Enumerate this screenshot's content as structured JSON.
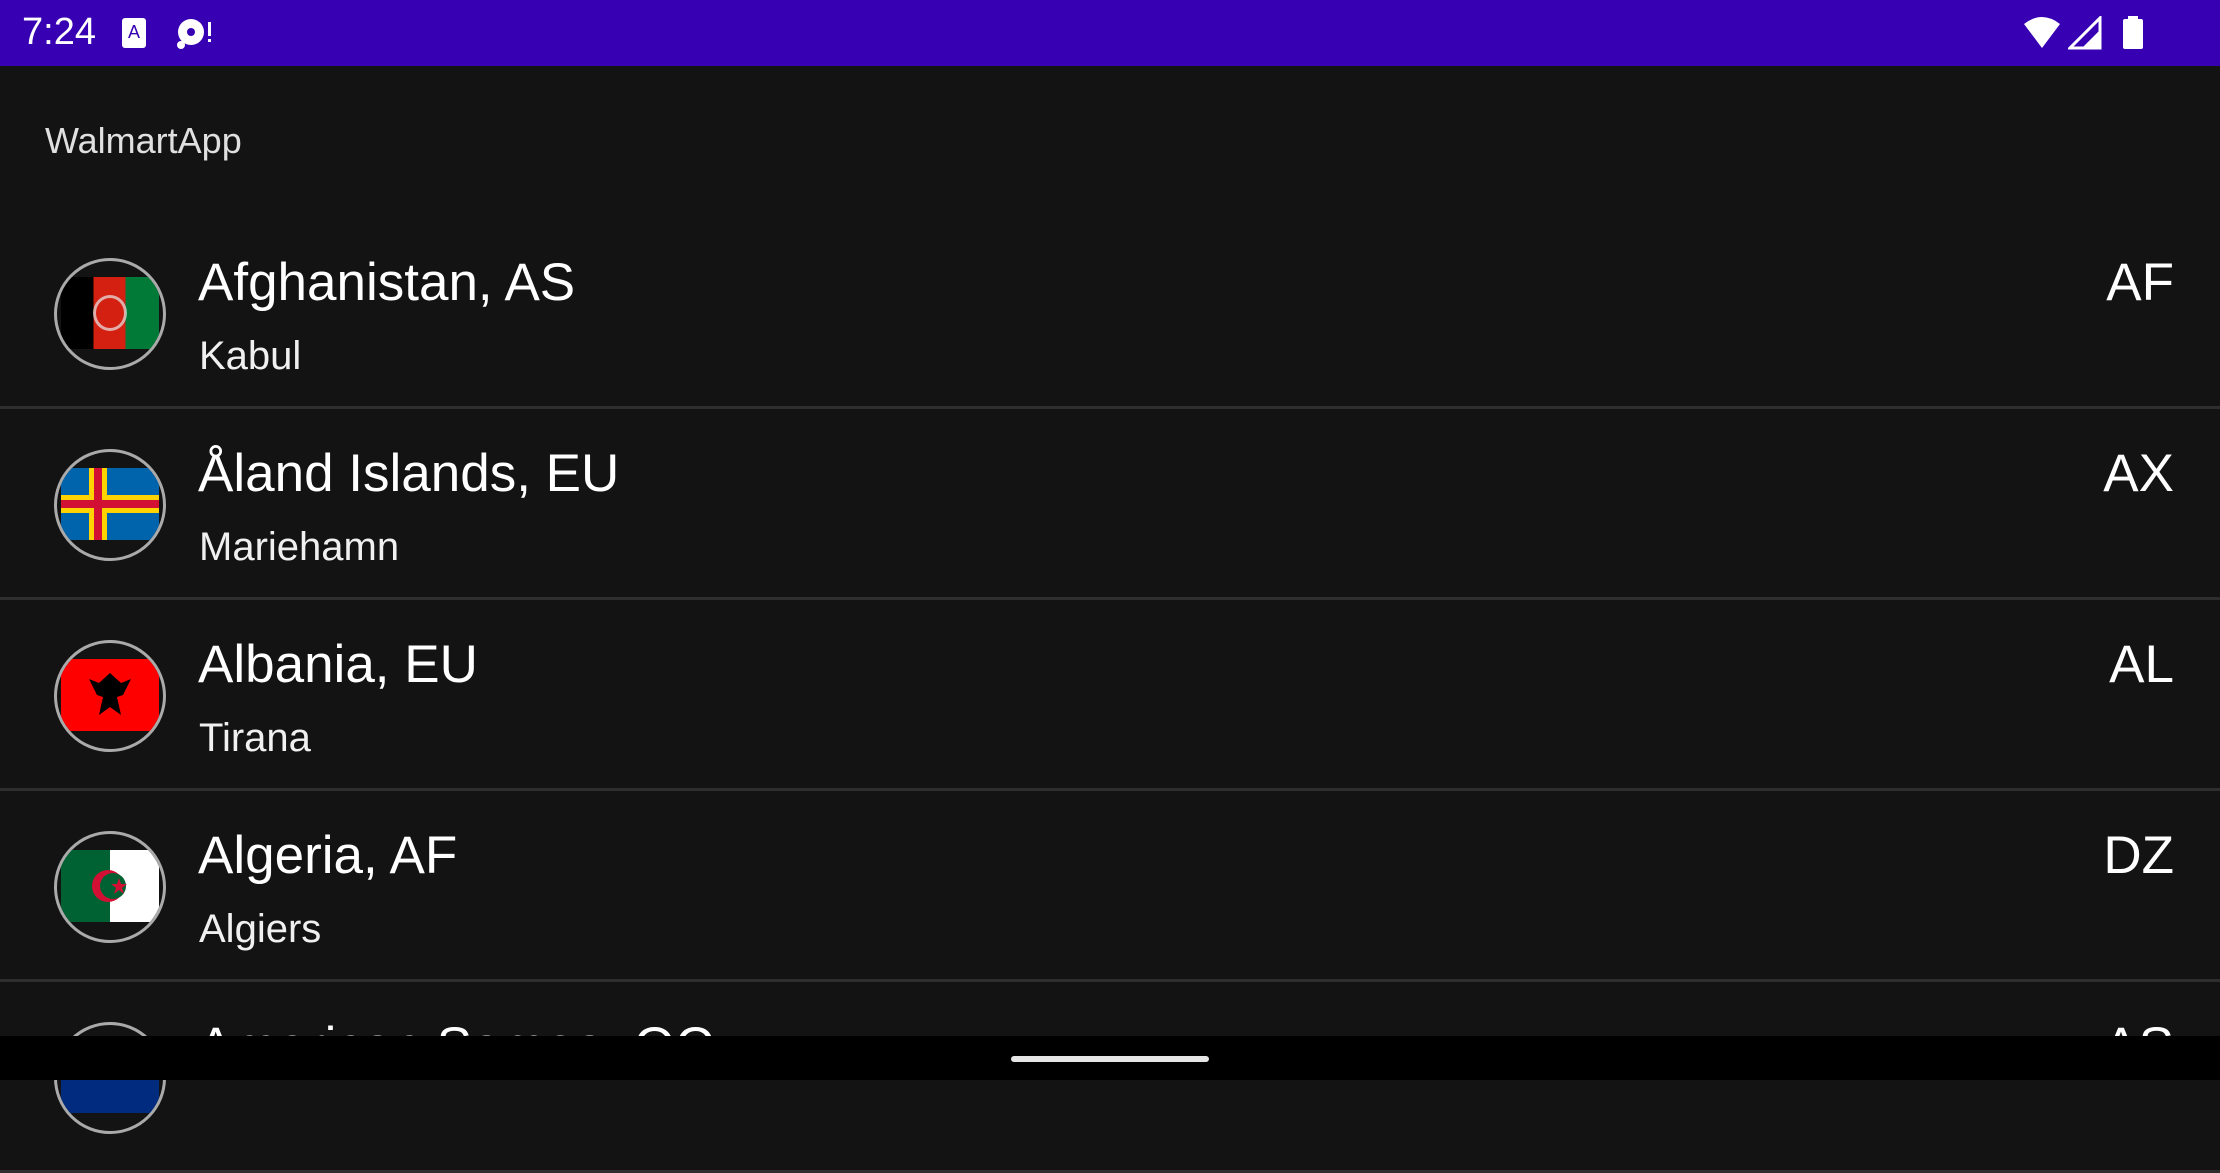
{
  "status_bar": {
    "time": "7:24",
    "icons": [
      "accessibility-icon",
      "disc-alert-icon",
      "wifi-icon",
      "signal-icon",
      "battery-icon"
    ],
    "color": "#3700b3"
  },
  "app_bar": {
    "title": "WalmartApp"
  },
  "countries": [
    {
      "name": "Afghanistan, AS",
      "capital": "Kabul",
      "code": "AF",
      "flag": "afghanistan-flag"
    },
    {
      "name": "Åland Islands, EU",
      "capital": "Mariehamn",
      "code": "AX",
      "flag": "aland-flag"
    },
    {
      "name": "Albania, EU",
      "capital": "Tirana",
      "code": "AL",
      "flag": "albania-flag"
    },
    {
      "name": "Algeria, AF",
      "capital": "Algiers",
      "code": "DZ",
      "flag": "algeria-flag"
    },
    {
      "name": "American Samoa, OC",
      "capital": "",
      "code": "AS",
      "flag": "american-samoa-flag"
    }
  ]
}
